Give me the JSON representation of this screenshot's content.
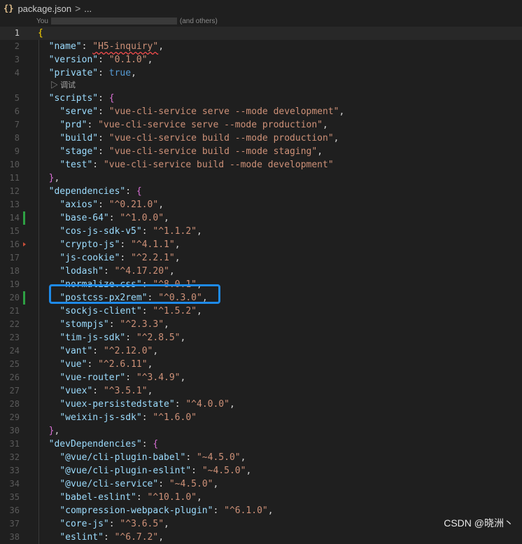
{
  "breadcrumb": {
    "file_icon": "{}",
    "filename": "package.json",
    "separator": ">",
    "more": "..."
  },
  "blame": {
    "prefix": "You",
    "suffix": "(and others)"
  },
  "codelens": {
    "debug_label": "调试"
  },
  "lines": [
    {
      "n": "1",
      "t": [
        [
          "{",
          "b1"
        ]
      ],
      "current": true
    },
    {
      "n": "2",
      "t": [
        [
          "  ",
          ""
        ],
        [
          "\"name\"",
          "k"
        ],
        [
          ": ",
          ""
        ],
        [
          "\"H5-inquiry\"",
          "s sq"
        ],
        [
          ",",
          ""
        ]
      ]
    },
    {
      "n": "3",
      "t": [
        [
          "  ",
          ""
        ],
        [
          "\"version\"",
          "k"
        ],
        [
          ": ",
          ""
        ],
        [
          "\"0.1.0\"",
          "s"
        ],
        [
          ",",
          ""
        ]
      ]
    },
    {
      "n": "4",
      "t": [
        [
          "  ",
          ""
        ],
        [
          "\"private\"",
          "k"
        ],
        [
          ": ",
          ""
        ],
        [
          "true",
          "kw"
        ],
        [
          ",",
          ""
        ]
      ]
    },
    {
      "n": "5",
      "t": [
        [
          "  ",
          ""
        ],
        [
          "\"scripts\"",
          "k"
        ],
        [
          ": ",
          ""
        ],
        [
          "{",
          "b2"
        ]
      ]
    },
    {
      "n": "6",
      "t": [
        [
          "    ",
          ""
        ],
        [
          "\"serve\"",
          "k"
        ],
        [
          ": ",
          ""
        ],
        [
          "\"vue-cli-service serve --mode development\"",
          "s"
        ],
        [
          ",",
          ""
        ]
      ]
    },
    {
      "n": "7",
      "t": [
        [
          "    ",
          ""
        ],
        [
          "\"prd\"",
          "k"
        ],
        [
          ": ",
          ""
        ],
        [
          "\"vue-cli-service serve --mode production\"",
          "s"
        ],
        [
          ",",
          ""
        ]
      ]
    },
    {
      "n": "8",
      "t": [
        [
          "    ",
          ""
        ],
        [
          "\"build\"",
          "k"
        ],
        [
          ": ",
          ""
        ],
        [
          "\"vue-cli-service build --mode production\"",
          "s"
        ],
        [
          ",",
          ""
        ]
      ]
    },
    {
      "n": "9",
      "t": [
        [
          "    ",
          ""
        ],
        [
          "\"stage\"",
          "k"
        ],
        [
          ": ",
          ""
        ],
        [
          "\"vue-cli-service build --mode staging\"",
          "s"
        ],
        [
          ",",
          ""
        ]
      ]
    },
    {
      "n": "10",
      "t": [
        [
          "    ",
          ""
        ],
        [
          "\"test\"",
          "k"
        ],
        [
          ": ",
          ""
        ],
        [
          "\"vue-cli-service build --mode development\"",
          "s"
        ]
      ]
    },
    {
      "n": "11",
      "t": [
        [
          "  ",
          ""
        ],
        [
          "}",
          "b2"
        ],
        [
          ",",
          ""
        ]
      ]
    },
    {
      "n": "12",
      "t": [
        [
          "  ",
          ""
        ],
        [
          "\"dependencies\"",
          "k"
        ],
        [
          ": ",
          ""
        ],
        [
          "{",
          "b2"
        ]
      ]
    },
    {
      "n": "13",
      "t": [
        [
          "    ",
          ""
        ],
        [
          "\"axios\"",
          "k"
        ],
        [
          ": ",
          ""
        ],
        [
          "\"^0.21.0\"",
          "s"
        ],
        [
          ",",
          ""
        ]
      ]
    },
    {
      "n": "14",
      "t": [
        [
          "    ",
          ""
        ],
        [
          "\"base-64\"",
          "k"
        ],
        [
          ": ",
          ""
        ],
        [
          "\"^1.0.0\"",
          "s"
        ],
        [
          ",",
          ""
        ]
      ],
      "mark": "add"
    },
    {
      "n": "15",
      "t": [
        [
          "    ",
          ""
        ],
        [
          "\"cos-js-sdk-v5\"",
          "k"
        ],
        [
          ": ",
          ""
        ],
        [
          "\"^1.1.2\"",
          "s"
        ],
        [
          ",",
          ""
        ]
      ]
    },
    {
      "n": "16",
      "t": [
        [
          "    ",
          ""
        ],
        [
          "\"crypto-js\"",
          "k"
        ],
        [
          ": ",
          ""
        ],
        [
          "\"^4.1.1\"",
          "s"
        ],
        [
          ",",
          ""
        ]
      ],
      "mark": "del"
    },
    {
      "n": "17",
      "t": [
        [
          "    ",
          ""
        ],
        [
          "\"js-cookie\"",
          "k"
        ],
        [
          ": ",
          ""
        ],
        [
          "\"^2.2.1\"",
          "s"
        ],
        [
          ",",
          ""
        ]
      ]
    },
    {
      "n": "18",
      "t": [
        [
          "    ",
          ""
        ],
        [
          "\"lodash\"",
          "k"
        ],
        [
          ": ",
          ""
        ],
        [
          "\"^4.17.20\"",
          "s"
        ],
        [
          ",",
          ""
        ]
      ]
    },
    {
      "n": "19",
      "t": [
        [
          "    ",
          ""
        ],
        [
          "\"normalize.css\"",
          "k"
        ],
        [
          ": ",
          ""
        ],
        [
          "\"^8.0.1\"",
          "s"
        ],
        [
          ",",
          ""
        ]
      ]
    },
    {
      "n": "20",
      "t": [
        [
          "    ",
          ""
        ],
        [
          "\"postcss-px2rem\"",
          "k"
        ],
        [
          ": ",
          ""
        ],
        [
          "\"^0.3.0\"",
          "s"
        ],
        [
          ",",
          ""
        ]
      ],
      "mark": "add"
    },
    {
      "n": "21",
      "t": [
        [
          "    ",
          ""
        ],
        [
          "\"sockjs-client\"",
          "k"
        ],
        [
          ": ",
          ""
        ],
        [
          "\"^1.5.2\"",
          "s"
        ],
        [
          ",",
          ""
        ]
      ]
    },
    {
      "n": "22",
      "t": [
        [
          "    ",
          ""
        ],
        [
          "\"stompjs\"",
          "k"
        ],
        [
          ": ",
          ""
        ],
        [
          "\"^2.3.3\"",
          "s"
        ],
        [
          ",",
          ""
        ]
      ]
    },
    {
      "n": "23",
      "t": [
        [
          "    ",
          ""
        ],
        [
          "\"tim-js-sdk\"",
          "k"
        ],
        [
          ": ",
          ""
        ],
        [
          "\"^2.8.5\"",
          "s"
        ],
        [
          ",",
          ""
        ]
      ]
    },
    {
      "n": "24",
      "t": [
        [
          "    ",
          ""
        ],
        [
          "\"vant\"",
          "k"
        ],
        [
          ": ",
          ""
        ],
        [
          "\"^2.12.0\"",
          "s"
        ],
        [
          ",",
          ""
        ]
      ]
    },
    {
      "n": "25",
      "t": [
        [
          "    ",
          ""
        ],
        [
          "\"vue\"",
          "k"
        ],
        [
          ": ",
          ""
        ],
        [
          "\"^2.6.11\"",
          "s"
        ],
        [
          ",",
          ""
        ]
      ]
    },
    {
      "n": "26",
      "t": [
        [
          "    ",
          ""
        ],
        [
          "\"vue-router\"",
          "k"
        ],
        [
          ": ",
          ""
        ],
        [
          "\"^3.4.9\"",
          "s"
        ],
        [
          ",",
          ""
        ]
      ]
    },
    {
      "n": "27",
      "t": [
        [
          "    ",
          ""
        ],
        [
          "\"vuex\"",
          "k"
        ],
        [
          ": ",
          ""
        ],
        [
          "\"^3.5.1\"",
          "s"
        ],
        [
          ",",
          ""
        ]
      ]
    },
    {
      "n": "28",
      "t": [
        [
          "    ",
          ""
        ],
        [
          "\"vuex-persistedstate\"",
          "k"
        ],
        [
          ": ",
          ""
        ],
        [
          "\"^4.0.0\"",
          "s"
        ],
        [
          ",",
          ""
        ]
      ]
    },
    {
      "n": "29",
      "t": [
        [
          "    ",
          ""
        ],
        [
          "\"weixin-js-sdk\"",
          "k"
        ],
        [
          ": ",
          ""
        ],
        [
          "\"^1.6.0\"",
          "s"
        ]
      ]
    },
    {
      "n": "30",
      "t": [
        [
          "  ",
          ""
        ],
        [
          "}",
          "b2"
        ],
        [
          ",",
          ""
        ]
      ]
    },
    {
      "n": "31",
      "t": [
        [
          "  ",
          ""
        ],
        [
          "\"devDependencies\"",
          "k"
        ],
        [
          ": ",
          ""
        ],
        [
          "{",
          "b2"
        ]
      ]
    },
    {
      "n": "32",
      "t": [
        [
          "    ",
          ""
        ],
        [
          "\"@vue/cli-plugin-babel\"",
          "k"
        ],
        [
          ": ",
          ""
        ],
        [
          "\"~4.5.0\"",
          "s"
        ],
        [
          ",",
          ""
        ]
      ]
    },
    {
      "n": "33",
      "t": [
        [
          "    ",
          ""
        ],
        [
          "\"@vue/cli-plugin-eslint\"",
          "k"
        ],
        [
          ": ",
          ""
        ],
        [
          "\"~4.5.0\"",
          "s"
        ],
        [
          ",",
          ""
        ]
      ]
    },
    {
      "n": "34",
      "t": [
        [
          "    ",
          ""
        ],
        [
          "\"@vue/cli-service\"",
          "k"
        ],
        [
          ": ",
          ""
        ],
        [
          "\"~4.5.0\"",
          "s"
        ],
        [
          ",",
          ""
        ]
      ]
    },
    {
      "n": "35",
      "t": [
        [
          "    ",
          ""
        ],
        [
          "\"babel-eslint\"",
          "k"
        ],
        [
          ": ",
          ""
        ],
        [
          "\"^10.1.0\"",
          "s"
        ],
        [
          ",",
          ""
        ]
      ]
    },
    {
      "n": "36",
      "t": [
        [
          "    ",
          ""
        ],
        [
          "\"compression-webpack-plugin\"",
          "k"
        ],
        [
          ": ",
          ""
        ],
        [
          "\"^6.1.0\"",
          "s"
        ],
        [
          ",",
          ""
        ]
      ]
    },
    {
      "n": "37",
      "t": [
        [
          "    ",
          ""
        ],
        [
          "\"core-js\"",
          "k"
        ],
        [
          ": ",
          ""
        ],
        [
          "\"^3.6.5\"",
          "s"
        ],
        [
          ",",
          ""
        ]
      ]
    },
    {
      "n": "38",
      "t": [
        [
          "    ",
          ""
        ],
        [
          "\"eslint\"",
          "k"
        ],
        [
          ": ",
          ""
        ],
        [
          "\"^6.7.2\"",
          "s"
        ],
        [
          ",",
          ""
        ]
      ]
    }
  ],
  "watermark": "CSDN @晓洲丶",
  "colors": {
    "highlight_box": "#1e8ae8",
    "string": "#ce9178",
    "key": "#9cdcfe",
    "keyword": "#569cd6"
  }
}
